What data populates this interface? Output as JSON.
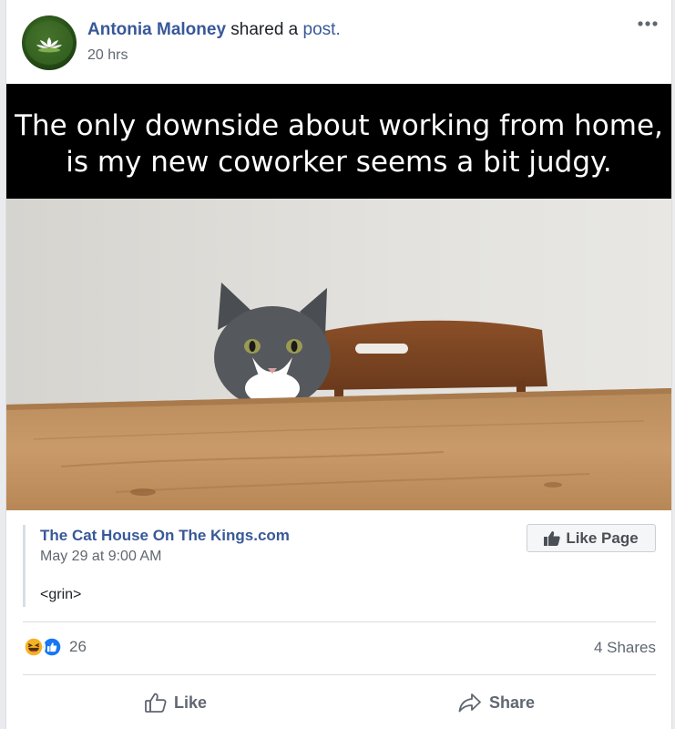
{
  "post": {
    "author": "Antonia Maloney",
    "action_text": "shared a",
    "post_link": "post.",
    "timestamp": "20 hrs",
    "image_caption_line1": "The only downside about working from home,",
    "image_caption_line2": "is my new coworker seems a bit judgy."
  },
  "shared": {
    "source_name": "The Cat House On The Kings.com",
    "date": "May 29 at 9:00 AM",
    "text": "<grin>",
    "like_page_label": "Like Page"
  },
  "stats": {
    "reaction_count": "26",
    "shares_label": "4 Shares",
    "reactions": [
      "haha-icon",
      "like-icon"
    ]
  },
  "actions": {
    "like_label": "Like",
    "share_label": "Share"
  },
  "colors": {
    "link_blue": "#385898",
    "like_blue": "#1877f2",
    "haha_yellow": "#f7b125",
    "muted_text": "#606770"
  }
}
